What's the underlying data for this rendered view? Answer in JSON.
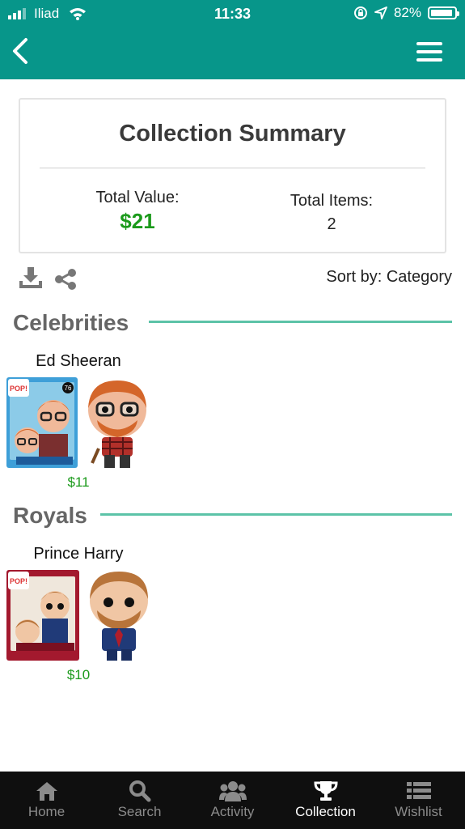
{
  "status_bar": {
    "carrier": "Iliad",
    "time": "11:33",
    "battery": "82%"
  },
  "summary": {
    "title": "Collection Summary",
    "total_value_label": "Total Value:",
    "total_value": "$21",
    "total_items_label": "Total Items:",
    "total_items": "2"
  },
  "toolbar": {
    "sort_label": "Sort by: Category"
  },
  "categories": [
    {
      "name": "Celebrities",
      "items": [
        {
          "name": "Ed Sheeran",
          "price": "$11",
          "box_number": "76"
        }
      ]
    },
    {
      "name": "Royals",
      "items": [
        {
          "name": "Prince Harry",
          "price": "$10"
        }
      ]
    }
  ],
  "tabs": [
    {
      "label": "Home",
      "icon": "home-icon",
      "active": false
    },
    {
      "label": "Search",
      "icon": "search-icon",
      "active": false
    },
    {
      "label": "Activity",
      "icon": "people-icon",
      "active": false
    },
    {
      "label": "Collection",
      "icon": "trophy-icon",
      "active": true
    },
    {
      "label": "Wishlist",
      "icon": "list-icon",
      "active": false
    }
  ],
  "colors": {
    "header": "#07968a",
    "accent_line": "#5cc3a8",
    "price": "#1b9a1b",
    "tabbar": "#0f0f0f"
  }
}
